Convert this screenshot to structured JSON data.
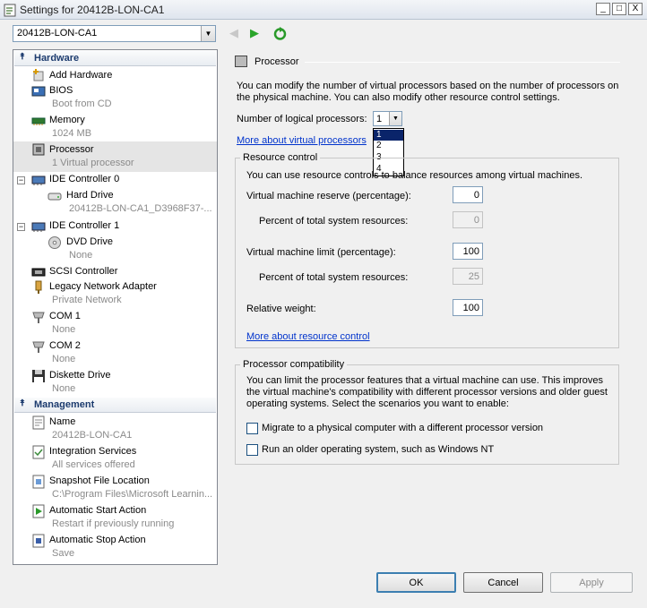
{
  "window": {
    "title": "Settings for 20412B-LON-CA1",
    "minimize": "_",
    "maximize": "□",
    "close": "X"
  },
  "vm_selector": {
    "value": "20412B-LON-CA1"
  },
  "sections": {
    "hardware": "Hardware",
    "management": "Management"
  },
  "hardware_items": [
    {
      "label": "Add Hardware",
      "sub": ""
    },
    {
      "label": "BIOS",
      "sub": "Boot from CD"
    },
    {
      "label": "Memory",
      "sub": "1024 MB"
    },
    {
      "label": "Processor",
      "sub": "1 Virtual processor"
    },
    {
      "label": "IDE Controller 0",
      "sub": ""
    },
    {
      "label": "Hard Drive",
      "sub": "20412B-LON-CA1_D3968F37-..."
    },
    {
      "label": "IDE Controller 1",
      "sub": ""
    },
    {
      "label": "DVD Drive",
      "sub": "None"
    },
    {
      "label": "SCSI Controller",
      "sub": ""
    },
    {
      "label": "Legacy Network Adapter",
      "sub": "Private Network"
    },
    {
      "label": "COM 1",
      "sub": "None"
    },
    {
      "label": "COM 2",
      "sub": "None"
    },
    {
      "label": "Diskette Drive",
      "sub": "None"
    }
  ],
  "management_items": [
    {
      "label": "Name",
      "sub": "20412B-LON-CA1"
    },
    {
      "label": "Integration Services",
      "sub": "All services offered"
    },
    {
      "label": "Snapshot File Location",
      "sub": "C:\\Program Files\\Microsoft Learnin..."
    },
    {
      "label": "Automatic Start Action",
      "sub": "Restart if previously running"
    },
    {
      "label": "Automatic Stop Action",
      "sub": "Save"
    }
  ],
  "processor": {
    "heading": "Processor",
    "description_line1": "You can modify the number of virtual processors based on the number of processors on",
    "description_line2": "the physical machine. You can also modify other resource control settings.",
    "logical_label": "Number of logical processors:",
    "logical_value": "1",
    "logical_options": [
      "1",
      "2",
      "3",
      "4"
    ],
    "more_link": "More about virtual processors"
  },
  "resource_control": {
    "title": "Resource control",
    "description": "You can use resource controls to balance resources among virtual machines.",
    "reserve_label": "Virtual machine reserve (percentage):",
    "reserve_value": "0",
    "reserve_pct_label": "Percent of total system resources:",
    "reserve_pct_value": "0",
    "limit_label": "Virtual machine limit (percentage):",
    "limit_value": "100",
    "limit_pct_label": "Percent of total system resources:",
    "limit_pct_value": "25",
    "weight_label": "Relative weight:",
    "weight_value": "100",
    "more_link": "More about resource control"
  },
  "compatibility": {
    "title": "Processor compatibility",
    "line1": "You can limit the processor features that a virtual machine can use. This improves",
    "line2": "the virtual machine's compatibility with different processor versions and older guest",
    "line3": "operating systems. Select the scenarios you want to enable:",
    "migrate_label": "Migrate to a physical computer with a different processor version",
    "older_os_label": "Run an older operating system, such as Windows NT"
  },
  "buttons": {
    "ok": "OK",
    "cancel": "Cancel",
    "apply": "Apply"
  }
}
